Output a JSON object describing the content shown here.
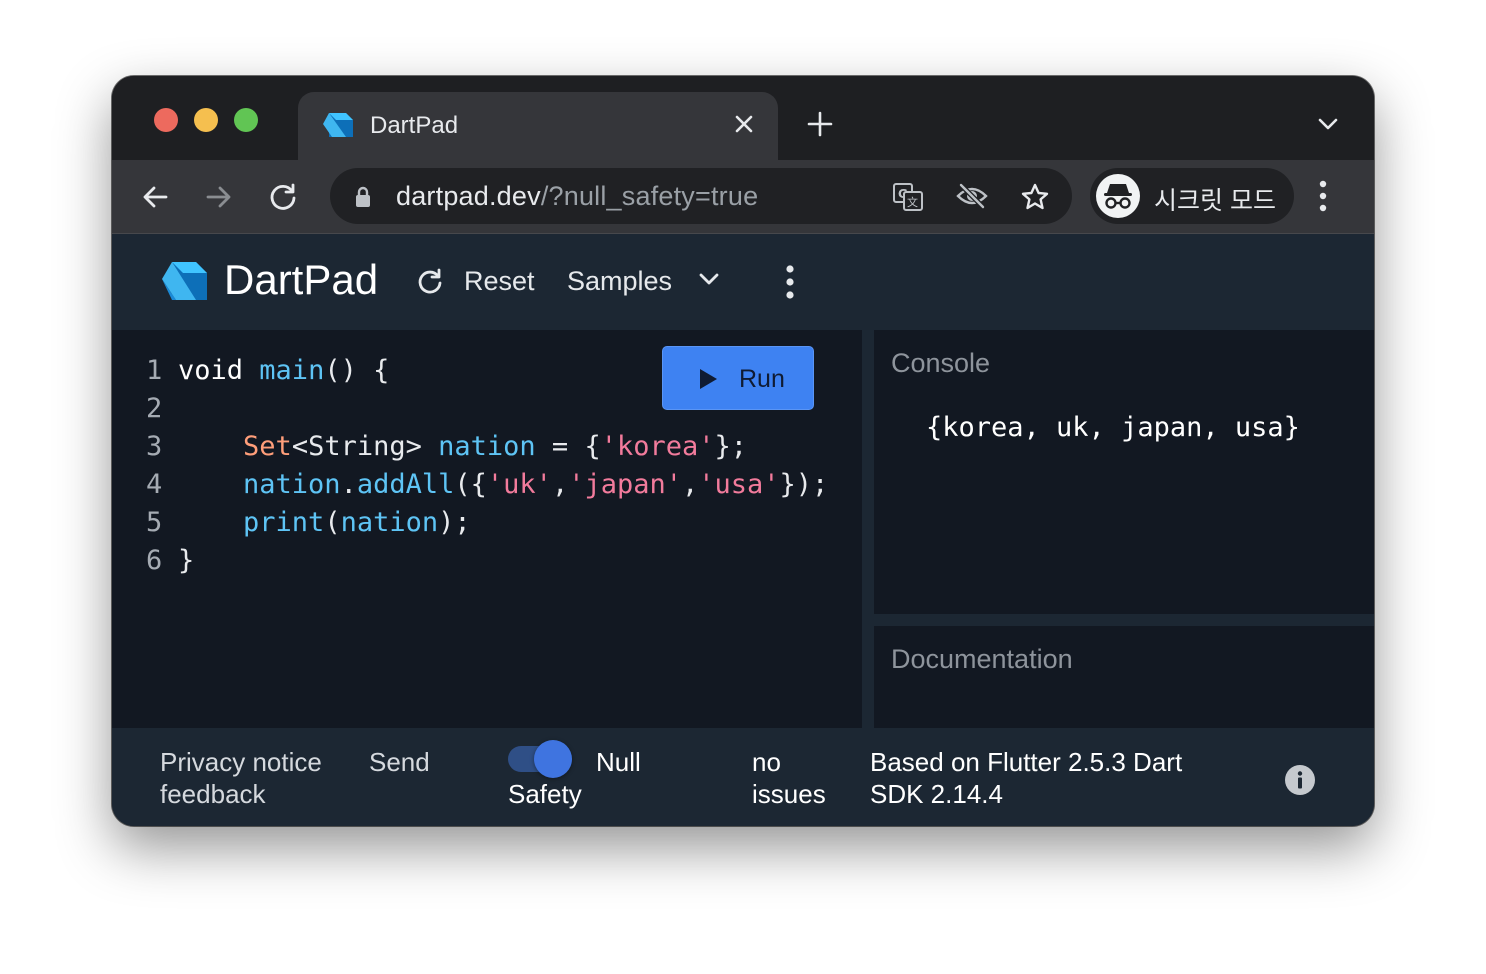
{
  "browser": {
    "tab_title": "DartPad",
    "url_host": "dartpad.dev",
    "url_path": "/?null_safety=true",
    "profile_label": "시크릿 모드"
  },
  "app": {
    "brand": "DartPad",
    "reset_label": "Reset",
    "samples_label": "Samples",
    "run_label": "Run"
  },
  "editor": {
    "lines": [
      {
        "num": "1",
        "tokens": [
          {
            "t": "void",
            "c": "kw"
          },
          {
            "t": " ",
            "c": ""
          },
          {
            "t": "main",
            "c": "fn"
          },
          {
            "t": "() {",
            "c": ""
          }
        ]
      },
      {
        "num": "2",
        "tokens": []
      },
      {
        "num": "3",
        "tokens": [
          {
            "t": "    ",
            "c": ""
          },
          {
            "t": "Set",
            "c": "ty"
          },
          {
            "t": "<String> ",
            "c": ""
          },
          {
            "t": "nation",
            "c": "fn"
          },
          {
            "t": " = {",
            "c": ""
          },
          {
            "t": "'korea'",
            "c": "st"
          },
          {
            "t": "};",
            "c": ""
          }
        ]
      },
      {
        "num": "4",
        "tokens": [
          {
            "t": "    ",
            "c": ""
          },
          {
            "t": "nation",
            "c": "fn"
          },
          {
            "t": ".",
            "c": ""
          },
          {
            "t": "addAll",
            "c": "fn"
          },
          {
            "t": "({",
            "c": ""
          },
          {
            "t": "'uk'",
            "c": "st"
          },
          {
            "t": ",",
            "c": ""
          },
          {
            "t": "'japan'",
            "c": "st"
          },
          {
            "t": ",",
            "c": ""
          },
          {
            "t": "'usa'",
            "c": "st"
          },
          {
            "t": "});",
            "c": ""
          }
        ]
      },
      {
        "num": "5",
        "tokens": [
          {
            "t": "    ",
            "c": ""
          },
          {
            "t": "print",
            "c": "fn"
          },
          {
            "t": "(",
            "c": ""
          },
          {
            "t": "nation",
            "c": "fn"
          },
          {
            "t": ");",
            "c": ""
          }
        ]
      },
      {
        "num": "6",
        "tokens": [
          {
            "t": "}",
            "c": ""
          }
        ]
      }
    ]
  },
  "console": {
    "title": "Console",
    "output": "{korea, uk, japan, usa}"
  },
  "documentation": {
    "title": "Documentation"
  },
  "status": {
    "privacy": "Privacy notice",
    "feedback": "feedback",
    "send": "Send",
    "null_label": "Null",
    "safety_label": "Safety",
    "null_safety_enabled": true,
    "issues_line1": "no",
    "issues_line2": "issues",
    "version_line1": "Based on Flutter 2.5.3 Dart",
    "version_line2": "SDK 2.14.4"
  },
  "icons": [
    "dart-logo-icon",
    "close-icon",
    "plus-icon",
    "chevron-down-icon",
    "back-arrow-icon",
    "forward-arrow-icon",
    "reload-icon",
    "lock-icon",
    "translate-icon",
    "eye-off-icon",
    "star-icon",
    "incognito-icon",
    "kebab-menu-icon",
    "play-icon",
    "info-icon"
  ],
  "colors": {
    "run_button": "#3e82f2",
    "editor_bg": "#121822",
    "header_bg": "#1c2733",
    "string": "#f27b9c",
    "identifier": "#5ec4f5",
    "type": "#ff9e7a"
  }
}
